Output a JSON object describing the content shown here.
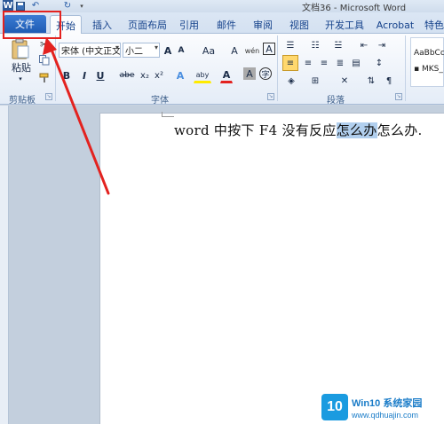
{
  "window": {
    "title": "文档36 - Microsoft Word"
  },
  "qat": {
    "app_icon": "W",
    "undo": "↶",
    "redo": "↻"
  },
  "tabs": [
    {
      "label": "文件"
    },
    {
      "label": "开始"
    },
    {
      "label": "插入"
    },
    {
      "label": "页面布局"
    },
    {
      "label": "引用"
    },
    {
      "label": "邮件"
    },
    {
      "label": "审阅"
    },
    {
      "label": "视图"
    },
    {
      "label": "开发工具"
    },
    {
      "label": "Acrobat"
    },
    {
      "label": "特色"
    }
  ],
  "ribbon": {
    "clipboard": {
      "paste_label": "粘贴",
      "group_label": "剪贴板"
    },
    "font": {
      "font_name": "宋体 (中文正文",
      "font_size": "小二",
      "grow": "A",
      "shrink": "A",
      "case": "Aa",
      "clear": "A",
      "pinyin": "wén",
      "border_char": "A",
      "bold": "B",
      "italic": "I",
      "underline": "U",
      "strike": "abe",
      "sub": "x₂",
      "sup": "x²",
      "text_effect": "A",
      "highlight": "aby",
      "font_color": "A",
      "char_shading": "A",
      "enclose": "字",
      "group_label": "字体"
    },
    "paragraph": {
      "group_label": "段落"
    },
    "styles": {
      "item1": "AaBbCcDi",
      "item2": "▪ MKS_"
    }
  },
  "document": {
    "text_before": "word 中按下 F4 没有反应",
    "text_selected": "怎么办",
    "text_after": "怎么办."
  },
  "watermark": {
    "logo": "10",
    "title": "Win10 系统家园",
    "url": "www.qdhuajin.com"
  },
  "colors": {
    "file_tab": "#1f5cb3",
    "highlight_box": "#e3221f",
    "selection": "#b1cfee"
  }
}
